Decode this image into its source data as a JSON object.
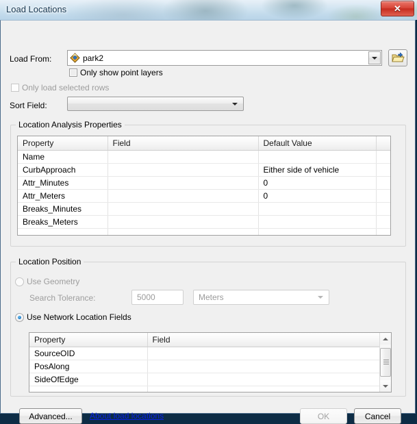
{
  "window": {
    "title": "Load Locations",
    "close_label": "✕",
    "close_icon": "close-icon"
  },
  "load_from": {
    "label": "Load From:",
    "value": "park2",
    "icon": "point-layer-diamond-icon",
    "browse_icon": "open-folder-icon"
  },
  "options": {
    "only_show_point_layers": "Only show point layers",
    "only_load_selected_rows": "Only load selected rows"
  },
  "sort_field": {
    "label": "Sort Field:",
    "value": ""
  },
  "location_analysis": {
    "title": "Location Analysis Properties",
    "columns": [
      "Property",
      "Field",
      "Default Value",
      ""
    ],
    "rows": [
      {
        "property": "Name",
        "field": "",
        "default_value": ""
      },
      {
        "property": "CurbApproach",
        "field": "",
        "default_value": "Either side of vehicle"
      },
      {
        "property": "Attr_Minutes",
        "field": "",
        "default_value": "0"
      },
      {
        "property": "Attr_Meters",
        "field": "",
        "default_value": "0"
      },
      {
        "property": "Breaks_Minutes",
        "field": "",
        "default_value": ""
      },
      {
        "property": "Breaks_Meters",
        "field": "",
        "default_value": ""
      },
      {
        "property": "",
        "field": "",
        "default_value": ""
      },
      {
        "property": "",
        "field": "",
        "default_value": ""
      }
    ]
  },
  "location_position": {
    "title": "Location Position",
    "use_geometry_label": "Use Geometry",
    "search_tolerance_label": "Search Tolerance:",
    "search_tolerance_value": "5000",
    "units_value": "Meters",
    "use_network_location_fields_label": "Use Network Location Fields",
    "network_columns": [
      "Property",
      "Field"
    ],
    "network_rows": [
      {
        "property": "SourceOID",
        "field": ""
      },
      {
        "property": "PosAlong",
        "field": ""
      },
      {
        "property": "SideOfEdge",
        "field": ""
      },
      {
        "property": "",
        "field": ""
      }
    ]
  },
  "footer": {
    "advanced": "Advanced...",
    "about_link": "About load locations",
    "ok": "OK",
    "cancel": "Cancel"
  }
}
